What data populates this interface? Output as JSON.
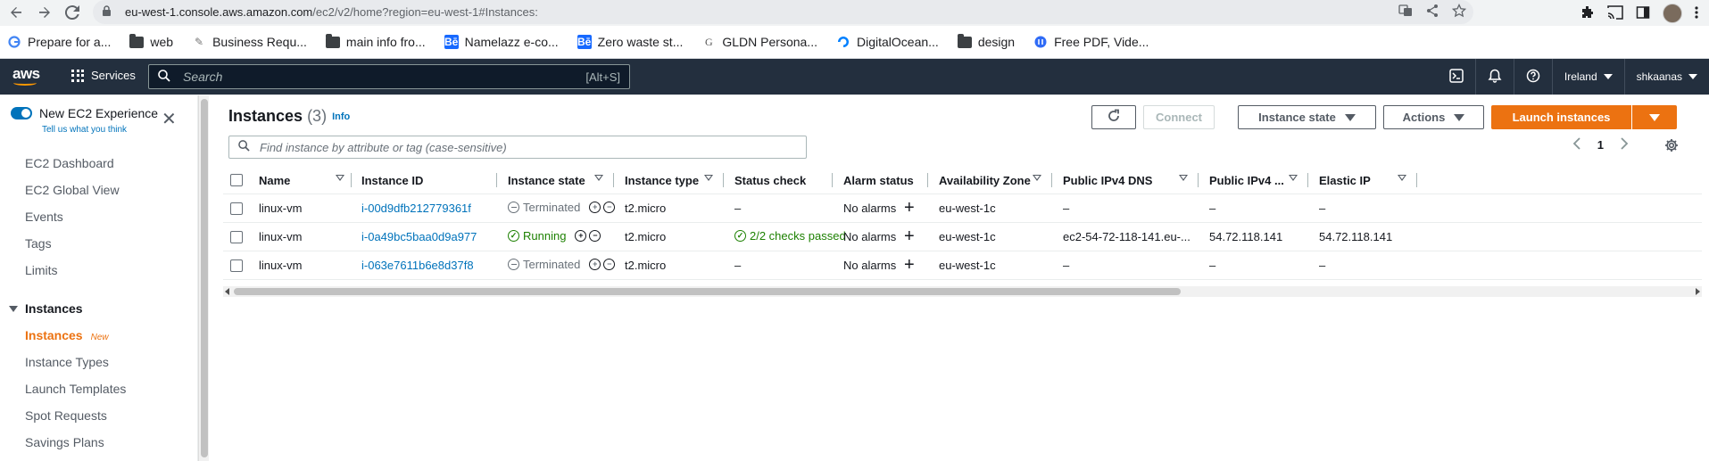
{
  "browser": {
    "url_host": "eu-west-1.console.aws.amazon.com",
    "url_path": "/ec2/v2/home?region=eu-west-1#Instances:",
    "bookmarks": [
      {
        "label": "Prepare for a...",
        "icon": "google-icon"
      },
      {
        "label": "web",
        "icon": "folder-icon"
      },
      {
        "label": "Business Requ...",
        "icon": "pen-icon"
      },
      {
        "label": "main info fro...",
        "icon": "folder-icon"
      },
      {
        "label": "Namelazz e-co...",
        "icon": "behance-icon"
      },
      {
        "label": "Zero waste st...",
        "icon": "behance-icon"
      },
      {
        "label": "GLDN Persona...",
        "icon": "g-icon"
      },
      {
        "label": "DigitalOcean...",
        "icon": "digitalocean-icon"
      },
      {
        "label": "design",
        "icon": "folder-icon"
      },
      {
        "label": "Free PDF, Vide...",
        "icon": "pdf-icon"
      }
    ]
  },
  "awsnav": {
    "logo": "aws",
    "services_label": "Services",
    "search_placeholder": "Search",
    "search_hint": "[Alt+S]",
    "region": "Ireland",
    "user": "shkaanas"
  },
  "sidebar": {
    "new_experience": "New EC2 Experience",
    "tell_us": "Tell us what you think",
    "items": [
      {
        "label": "EC2 Dashboard"
      },
      {
        "label": "EC2 Global View"
      },
      {
        "label": "Events"
      },
      {
        "label": "Tags"
      },
      {
        "label": "Limits"
      }
    ],
    "section_title": "Instances",
    "section_items": [
      {
        "label": "Instances",
        "badge": "New",
        "active": true
      },
      {
        "label": "Instance Types"
      },
      {
        "label": "Launch Templates"
      },
      {
        "label": "Spot Requests"
      },
      {
        "label": "Savings Plans"
      }
    ]
  },
  "main": {
    "title": "Instances",
    "count": "(3)",
    "info": "Info",
    "connect_label": "Connect",
    "instance_state_label": "Instance state",
    "actions_label": "Actions",
    "launch_label": "Launch instances",
    "filter_placeholder": "Find instance by attribute or tag (case-sensitive)",
    "page_number": "1",
    "columns": [
      "Name",
      "Instance ID",
      "Instance state",
      "Instance type",
      "Status check",
      "Alarm status",
      "Availability Zone",
      "Public IPv4 DNS",
      "Public IPv4 ...",
      "Elastic IP"
    ],
    "rows": [
      {
        "name": "linux-vm",
        "id": "i-00d9dfb212779361f",
        "state": "Terminated",
        "type": "t2.micro",
        "status": "–",
        "alarm": "No alarms",
        "az": "eu-west-1c",
        "dns": "–",
        "ipv4": "–",
        "eip": "–"
      },
      {
        "name": "linux-vm",
        "id": "i-0a49bc5baa0d9a977",
        "state": "Running",
        "type": "t2.micro",
        "status": "2/2 checks passed",
        "alarm": "No alarms",
        "az": "eu-west-1c",
        "dns": "ec2-54-72-118-141.eu-...",
        "ipv4": "54.72.118.141",
        "eip": "54.72.118.141"
      },
      {
        "name": "linux-vm",
        "id": "i-063e7611b6e8d37f8",
        "state": "Terminated",
        "type": "t2.micro",
        "status": "–",
        "alarm": "No alarms",
        "az": "eu-west-1c",
        "dns": "–",
        "ipv4": "–",
        "eip": "–"
      }
    ]
  },
  "colors": {
    "aws_nav": "#232f3e",
    "accent_orange": "#ec7211",
    "link_blue": "#0073bb",
    "running_green": "#1d8102"
  }
}
